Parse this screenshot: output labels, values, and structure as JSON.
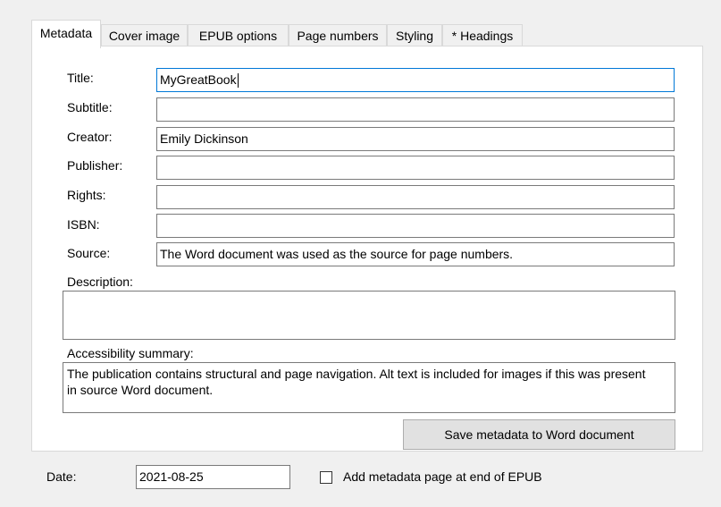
{
  "tabs": [
    "Metadata",
    "Cover image",
    "EPUB options",
    "Page numbers",
    "Styling",
    "* Headings"
  ],
  "fields": {
    "title": {
      "label": "Title:",
      "value": "MyGreatBook"
    },
    "subtitle": {
      "label": "Subtitle:",
      "value": ""
    },
    "creator": {
      "label": "Creator:",
      "value": "Emily Dickinson"
    },
    "publisher": {
      "label": "Publisher:",
      "value": ""
    },
    "rights": {
      "label": "Rights:",
      "value": ""
    },
    "isbn": {
      "label": "ISBN:",
      "value": ""
    },
    "source": {
      "label": "Source:",
      "value": "The Word document was used as the source for page numbers."
    }
  },
  "description": {
    "label": "Description:",
    "value": ""
  },
  "accessibility": {
    "label": "Accessibility summary:",
    "value": "The publication contains structural and page navigation. Alt text is included for images if this was present in source Word document."
  },
  "save_button": "Save metadata to Word document",
  "date": {
    "label": "Date:",
    "value": "2021-08-25"
  },
  "add_page_checkbox": {
    "label": "Add metadata page at end of EPUB",
    "checked": false
  }
}
